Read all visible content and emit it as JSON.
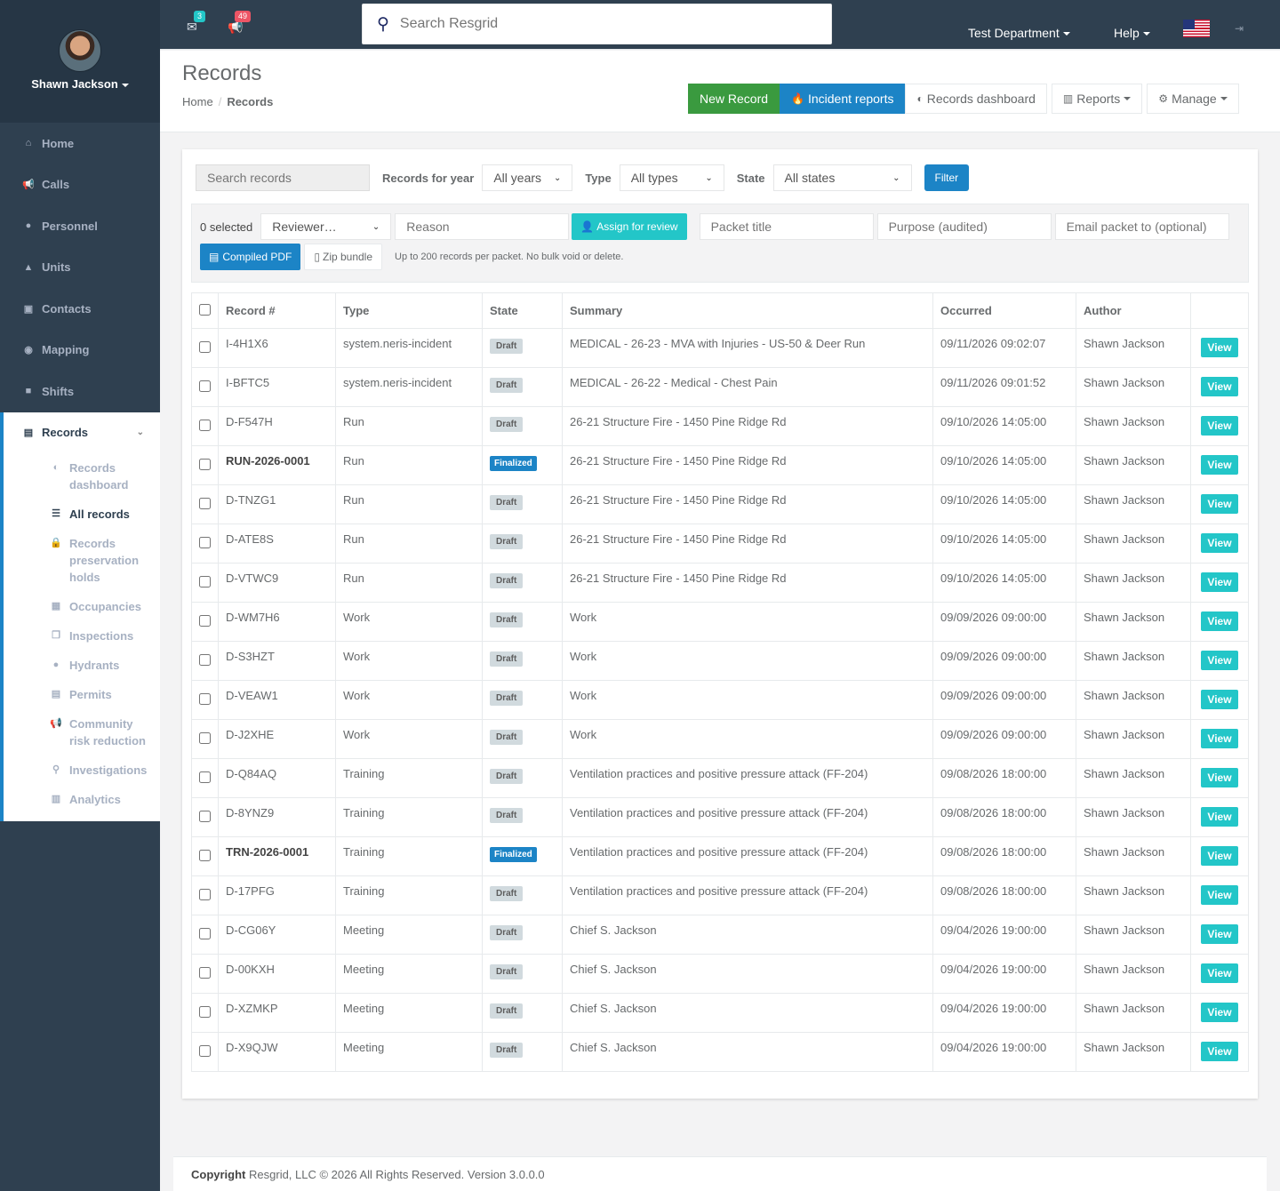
{
  "user": {
    "name": "Shawn Jackson"
  },
  "nav": [
    {
      "label": "Home",
      "icon": "home-icon",
      "glyph": "⌂"
    },
    {
      "label": "Calls",
      "icon": "megaphone-icon",
      "glyph": "📢"
    },
    {
      "label": "Personnel",
      "icon": "user-icon",
      "glyph": "●"
    },
    {
      "label": "Units",
      "icon": "units-icon",
      "glyph": "▲"
    },
    {
      "label": "Contacts",
      "icon": "contacts-icon",
      "glyph": "▣"
    },
    {
      "label": "Mapping",
      "icon": "map-marker-icon",
      "glyph": "◉"
    },
    {
      "label": "Shifts",
      "icon": "briefcase-icon",
      "glyph": "■"
    }
  ],
  "records_nav": {
    "label": "Records",
    "sub": [
      {
        "label": "Records dashboard",
        "icon": "dashboard-icon",
        "glyph": "◐"
      },
      {
        "label": "All records",
        "icon": "list-icon",
        "glyph": "☰"
      },
      {
        "label": "Records preservation holds",
        "icon": "lock-icon",
        "glyph": "🔒"
      },
      {
        "label": "Occupancies",
        "icon": "building-icon",
        "glyph": "▦"
      },
      {
        "label": "Inspections",
        "icon": "copy-icon",
        "glyph": "❐"
      },
      {
        "label": "Hydrants",
        "icon": "tint-icon",
        "glyph": "●"
      },
      {
        "label": "Permits",
        "icon": "file-icon",
        "glyph": "▤"
      },
      {
        "label": "Community risk reduction",
        "icon": "bullhorn-icon",
        "glyph": "📢"
      },
      {
        "label": "Investigations",
        "icon": "search-icon",
        "glyph": "⚲"
      },
      {
        "label": "Analytics",
        "icon": "bar-chart-icon",
        "glyph": "▥"
      }
    ]
  },
  "topbar": {
    "messages_count": "3",
    "alerts_count": "49",
    "search_placeholder": "Search Resgrid",
    "department": "Test Department",
    "help": "Help",
    "colors": {
      "messages_badge": "#23c6c8",
      "alerts_badge": "#ed5565"
    }
  },
  "heading": {
    "title": "Records",
    "breadcrumb_home": "Home",
    "breadcrumb_current": "Records",
    "btn_new": "New Record",
    "btn_incident": "Incident reports",
    "btn_dashboard": "Records dashboard",
    "btn_reports": "Reports",
    "btn_manage": "Manage"
  },
  "filters": {
    "search_placeholder": "Search records",
    "year_label": "Records for year",
    "year_value": "All years",
    "type_label": "Type",
    "type_value": "All types",
    "state_label": "State",
    "state_value": "All states",
    "filter_btn": "Filter"
  },
  "bulk": {
    "selected": "0 selected",
    "reviewer": "Reviewer…",
    "reason_placeholder": "Reason",
    "assign_btn": "Assign for review",
    "packet_title_placeholder": "Packet title",
    "purpose_placeholder": "Purpose (audited)",
    "email_placeholder": "Email packet to (optional)",
    "pdf_btn": "Compiled PDF",
    "zip_btn": "Zip bundle",
    "hint": "Up to 200 records per packet. No bulk void or delete."
  },
  "table": {
    "headers": {
      "record": "Record #",
      "type": "Type",
      "state": "State",
      "summary": "Summary",
      "occurred": "Occurred",
      "author": "Author"
    },
    "view_label": "View",
    "rows": [
      {
        "id": "I-4H1X6",
        "type": "system.neris-incident",
        "state": "Draft",
        "summary": "MEDICAL - 26-23 - MVA with Injuries - US-50 & Deer Run",
        "occurred": "09/11/2026 09:02:07",
        "author": "Shawn Jackson"
      },
      {
        "id": "I-BFTC5",
        "type": "system.neris-incident",
        "state": "Draft",
        "summary": "MEDICAL - 26-22 - Medical - Chest Pain",
        "occurred": "09/11/2026 09:01:52",
        "author": "Shawn Jackson"
      },
      {
        "id": "D-F547H",
        "type": "Run",
        "state": "Draft",
        "summary": "26-21 Structure Fire - 1450 Pine Ridge Rd",
        "occurred": "09/10/2026 14:05:00",
        "author": "Shawn Jackson"
      },
      {
        "id": "RUN-2026-0001",
        "type": "Run",
        "state": "Finalized",
        "summary": "26-21 Structure Fire - 1450 Pine Ridge Rd",
        "occurred": "09/10/2026 14:05:00",
        "author": "Shawn Jackson"
      },
      {
        "id": "D-TNZG1",
        "type": "Run",
        "state": "Draft",
        "summary": "26-21 Structure Fire - 1450 Pine Ridge Rd",
        "occurred": "09/10/2026 14:05:00",
        "author": "Shawn Jackson"
      },
      {
        "id": "D-ATE8S",
        "type": "Run",
        "state": "Draft",
        "summary": "26-21 Structure Fire - 1450 Pine Ridge Rd",
        "occurred": "09/10/2026 14:05:00",
        "author": "Shawn Jackson"
      },
      {
        "id": "D-VTWC9",
        "type": "Run",
        "state": "Draft",
        "summary": "26-21 Structure Fire - 1450 Pine Ridge Rd",
        "occurred": "09/10/2026 14:05:00",
        "author": "Shawn Jackson"
      },
      {
        "id": "D-WM7H6",
        "type": "Work",
        "state": "Draft",
        "summary": "Work",
        "occurred": "09/09/2026 09:00:00",
        "author": "Shawn Jackson"
      },
      {
        "id": "D-S3HZT",
        "type": "Work",
        "state": "Draft",
        "summary": "Work",
        "occurred": "09/09/2026 09:00:00",
        "author": "Shawn Jackson"
      },
      {
        "id": "D-VEAW1",
        "type": "Work",
        "state": "Draft",
        "summary": "Work",
        "occurred": "09/09/2026 09:00:00",
        "author": "Shawn Jackson"
      },
      {
        "id": "D-J2XHE",
        "type": "Work",
        "state": "Draft",
        "summary": "Work",
        "occurred": "09/09/2026 09:00:00",
        "author": "Shawn Jackson"
      },
      {
        "id": "D-Q84AQ",
        "type": "Training",
        "state": "Draft",
        "summary": "Ventilation practices and positive pressure attack (FF-204)",
        "occurred": "09/08/2026 18:00:00",
        "author": "Shawn Jackson"
      },
      {
        "id": "D-8YNZ9",
        "type": "Training",
        "state": "Draft",
        "summary": "Ventilation practices and positive pressure attack (FF-204)",
        "occurred": "09/08/2026 18:00:00",
        "author": "Shawn Jackson"
      },
      {
        "id": "TRN-2026-0001",
        "type": "Training",
        "state": "Finalized",
        "summary": "Ventilation practices and positive pressure attack (FF-204)",
        "occurred": "09/08/2026 18:00:00",
        "author": "Shawn Jackson"
      },
      {
        "id": "D-17PFG",
        "type": "Training",
        "state": "Draft",
        "summary": "Ventilation practices and positive pressure attack (FF-204)",
        "occurred": "09/08/2026 18:00:00",
        "author": "Shawn Jackson"
      },
      {
        "id": "D-CG06Y",
        "type": "Meeting",
        "state": "Draft",
        "summary": "Chief S. Jackson",
        "occurred": "09/04/2026 19:00:00",
        "author": "Shawn Jackson"
      },
      {
        "id": "D-00KXH",
        "type": "Meeting",
        "state": "Draft",
        "summary": "Chief S. Jackson",
        "occurred": "09/04/2026 19:00:00",
        "author": "Shawn Jackson"
      },
      {
        "id": "D-XZMKP",
        "type": "Meeting",
        "state": "Draft",
        "summary": "Chief S. Jackson",
        "occurred": "09/04/2026 19:00:00",
        "author": "Shawn Jackson"
      },
      {
        "id": "D-X9QJW",
        "type": "Meeting",
        "state": "Draft",
        "summary": "Chief S. Jackson",
        "occurred": "09/04/2026 19:00:00",
        "author": "Shawn Jackson"
      }
    ]
  },
  "footer": {
    "copyright_label": "Copyright",
    "text": "Resgrid, LLC © 2026 All Rights Reserved.",
    "version": "Version 3.0.0.0"
  }
}
